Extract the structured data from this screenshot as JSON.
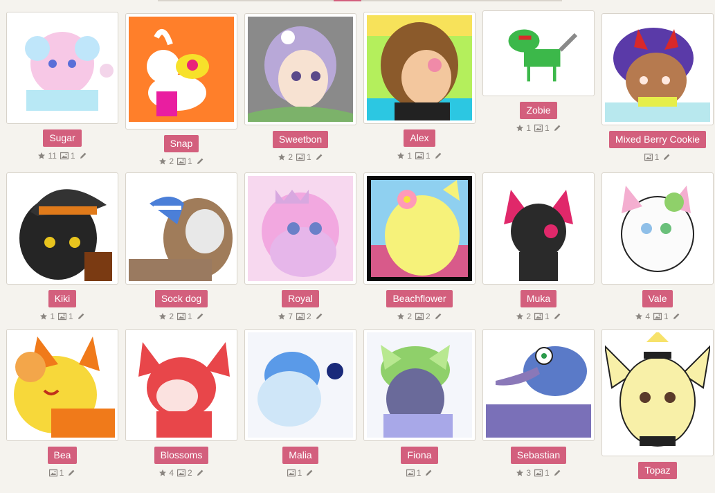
{
  "colors": {
    "accent": "#d35f7d",
    "background": "#f5f3ee",
    "stat_text": "#8a8580"
  },
  "characters": [
    {
      "name": "Sugar",
      "stars": "11",
      "images": "1"
    },
    {
      "name": "Snap",
      "stars": "2",
      "images": "1"
    },
    {
      "name": "Sweetbon",
      "stars": "2",
      "images": "1"
    },
    {
      "name": "Alex",
      "stars": "1",
      "images": "1"
    },
    {
      "name": "Zobie",
      "stars": "1",
      "images": "1"
    },
    {
      "name": "Mixed Berry Cookie",
      "stars": null,
      "images": "1"
    },
    {
      "name": "Kiki",
      "stars": "1",
      "images": "1"
    },
    {
      "name": "Sock dog",
      "stars": "2",
      "images": "1"
    },
    {
      "name": "Royal",
      "stars": "7",
      "images": "2"
    },
    {
      "name": "Beachflower",
      "stars": "2",
      "images": "2"
    },
    {
      "name": "Muka",
      "stars": "2",
      "images": "1"
    },
    {
      "name": "Vale",
      "stars": "4",
      "images": "1"
    },
    {
      "name": "Bea",
      "stars": null,
      "images": "1"
    },
    {
      "name": "Blossoms",
      "stars": "4",
      "images": "2"
    },
    {
      "name": "Malia",
      "stars": null,
      "images": "1"
    },
    {
      "name": "Fiona",
      "stars": null,
      "images": "1"
    },
    {
      "name": "Sebastian",
      "stars": "3",
      "images": "1"
    },
    {
      "name": "Topaz",
      "stars": null,
      "images": null
    }
  ],
  "icons": {
    "star": "star-icon",
    "image": "image-icon",
    "edit": "pencil-icon"
  }
}
